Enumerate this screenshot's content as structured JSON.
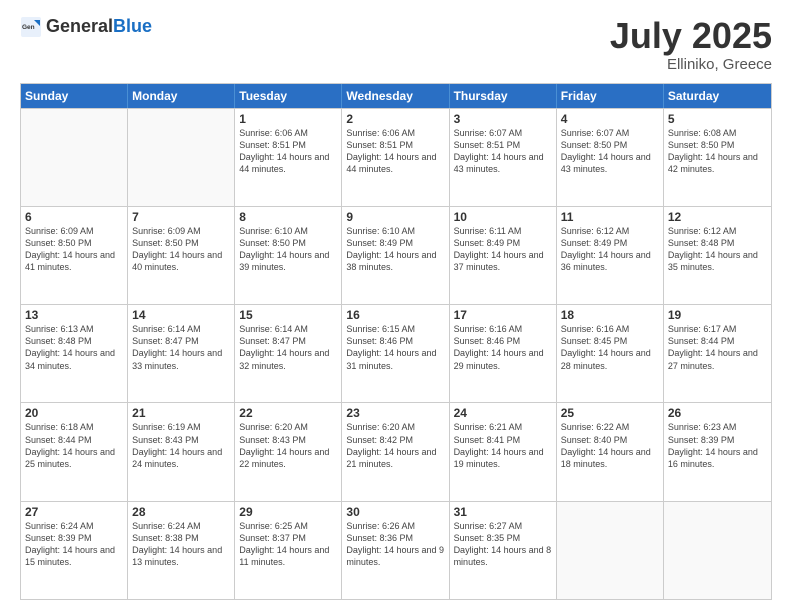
{
  "logo": {
    "general": "General",
    "blue": "Blue"
  },
  "title": {
    "month": "July 2025",
    "location": "Elliniko, Greece"
  },
  "days": [
    "Sunday",
    "Monday",
    "Tuesday",
    "Wednesday",
    "Thursday",
    "Friday",
    "Saturday"
  ],
  "weeks": [
    [
      {
        "day": "",
        "empty": true
      },
      {
        "day": "",
        "empty": true
      },
      {
        "day": "1",
        "sunrise": "Sunrise: 6:06 AM",
        "sunset": "Sunset: 8:51 PM",
        "daylight": "Daylight: 14 hours and 44 minutes."
      },
      {
        "day": "2",
        "sunrise": "Sunrise: 6:06 AM",
        "sunset": "Sunset: 8:51 PM",
        "daylight": "Daylight: 14 hours and 44 minutes."
      },
      {
        "day": "3",
        "sunrise": "Sunrise: 6:07 AM",
        "sunset": "Sunset: 8:51 PM",
        "daylight": "Daylight: 14 hours and 43 minutes."
      },
      {
        "day": "4",
        "sunrise": "Sunrise: 6:07 AM",
        "sunset": "Sunset: 8:50 PM",
        "daylight": "Daylight: 14 hours and 43 minutes."
      },
      {
        "day": "5",
        "sunrise": "Sunrise: 6:08 AM",
        "sunset": "Sunset: 8:50 PM",
        "daylight": "Daylight: 14 hours and 42 minutes."
      }
    ],
    [
      {
        "day": "6",
        "sunrise": "Sunrise: 6:09 AM",
        "sunset": "Sunset: 8:50 PM",
        "daylight": "Daylight: 14 hours and 41 minutes."
      },
      {
        "day": "7",
        "sunrise": "Sunrise: 6:09 AM",
        "sunset": "Sunset: 8:50 PM",
        "daylight": "Daylight: 14 hours and 40 minutes."
      },
      {
        "day": "8",
        "sunrise": "Sunrise: 6:10 AM",
        "sunset": "Sunset: 8:50 PM",
        "daylight": "Daylight: 14 hours and 39 minutes."
      },
      {
        "day": "9",
        "sunrise": "Sunrise: 6:10 AM",
        "sunset": "Sunset: 8:49 PM",
        "daylight": "Daylight: 14 hours and 38 minutes."
      },
      {
        "day": "10",
        "sunrise": "Sunrise: 6:11 AM",
        "sunset": "Sunset: 8:49 PM",
        "daylight": "Daylight: 14 hours and 37 minutes."
      },
      {
        "day": "11",
        "sunrise": "Sunrise: 6:12 AM",
        "sunset": "Sunset: 8:49 PM",
        "daylight": "Daylight: 14 hours and 36 minutes."
      },
      {
        "day": "12",
        "sunrise": "Sunrise: 6:12 AM",
        "sunset": "Sunset: 8:48 PM",
        "daylight": "Daylight: 14 hours and 35 minutes."
      }
    ],
    [
      {
        "day": "13",
        "sunrise": "Sunrise: 6:13 AM",
        "sunset": "Sunset: 8:48 PM",
        "daylight": "Daylight: 14 hours and 34 minutes."
      },
      {
        "day": "14",
        "sunrise": "Sunrise: 6:14 AM",
        "sunset": "Sunset: 8:47 PM",
        "daylight": "Daylight: 14 hours and 33 minutes."
      },
      {
        "day": "15",
        "sunrise": "Sunrise: 6:14 AM",
        "sunset": "Sunset: 8:47 PM",
        "daylight": "Daylight: 14 hours and 32 minutes."
      },
      {
        "day": "16",
        "sunrise": "Sunrise: 6:15 AM",
        "sunset": "Sunset: 8:46 PM",
        "daylight": "Daylight: 14 hours and 31 minutes."
      },
      {
        "day": "17",
        "sunrise": "Sunrise: 6:16 AM",
        "sunset": "Sunset: 8:46 PM",
        "daylight": "Daylight: 14 hours and 29 minutes."
      },
      {
        "day": "18",
        "sunrise": "Sunrise: 6:16 AM",
        "sunset": "Sunset: 8:45 PM",
        "daylight": "Daylight: 14 hours and 28 minutes."
      },
      {
        "day": "19",
        "sunrise": "Sunrise: 6:17 AM",
        "sunset": "Sunset: 8:44 PM",
        "daylight": "Daylight: 14 hours and 27 minutes."
      }
    ],
    [
      {
        "day": "20",
        "sunrise": "Sunrise: 6:18 AM",
        "sunset": "Sunset: 8:44 PM",
        "daylight": "Daylight: 14 hours and 25 minutes."
      },
      {
        "day": "21",
        "sunrise": "Sunrise: 6:19 AM",
        "sunset": "Sunset: 8:43 PM",
        "daylight": "Daylight: 14 hours and 24 minutes."
      },
      {
        "day": "22",
        "sunrise": "Sunrise: 6:20 AM",
        "sunset": "Sunset: 8:43 PM",
        "daylight": "Daylight: 14 hours and 22 minutes."
      },
      {
        "day": "23",
        "sunrise": "Sunrise: 6:20 AM",
        "sunset": "Sunset: 8:42 PM",
        "daylight": "Daylight: 14 hours and 21 minutes."
      },
      {
        "day": "24",
        "sunrise": "Sunrise: 6:21 AM",
        "sunset": "Sunset: 8:41 PM",
        "daylight": "Daylight: 14 hours and 19 minutes."
      },
      {
        "day": "25",
        "sunrise": "Sunrise: 6:22 AM",
        "sunset": "Sunset: 8:40 PM",
        "daylight": "Daylight: 14 hours and 18 minutes."
      },
      {
        "day": "26",
        "sunrise": "Sunrise: 6:23 AM",
        "sunset": "Sunset: 8:39 PM",
        "daylight": "Daylight: 14 hours and 16 minutes."
      }
    ],
    [
      {
        "day": "27",
        "sunrise": "Sunrise: 6:24 AM",
        "sunset": "Sunset: 8:39 PM",
        "daylight": "Daylight: 14 hours and 15 minutes."
      },
      {
        "day": "28",
        "sunrise": "Sunrise: 6:24 AM",
        "sunset": "Sunset: 8:38 PM",
        "daylight": "Daylight: 14 hours and 13 minutes."
      },
      {
        "day": "29",
        "sunrise": "Sunrise: 6:25 AM",
        "sunset": "Sunset: 8:37 PM",
        "daylight": "Daylight: 14 hours and 11 minutes."
      },
      {
        "day": "30",
        "sunrise": "Sunrise: 6:26 AM",
        "sunset": "Sunset: 8:36 PM",
        "daylight": "Daylight: 14 hours and 9 minutes."
      },
      {
        "day": "31",
        "sunrise": "Sunrise: 6:27 AM",
        "sunset": "Sunset: 8:35 PM",
        "daylight": "Daylight: 14 hours and 8 minutes."
      },
      {
        "day": "",
        "empty": true
      },
      {
        "day": "",
        "empty": true
      }
    ]
  ]
}
